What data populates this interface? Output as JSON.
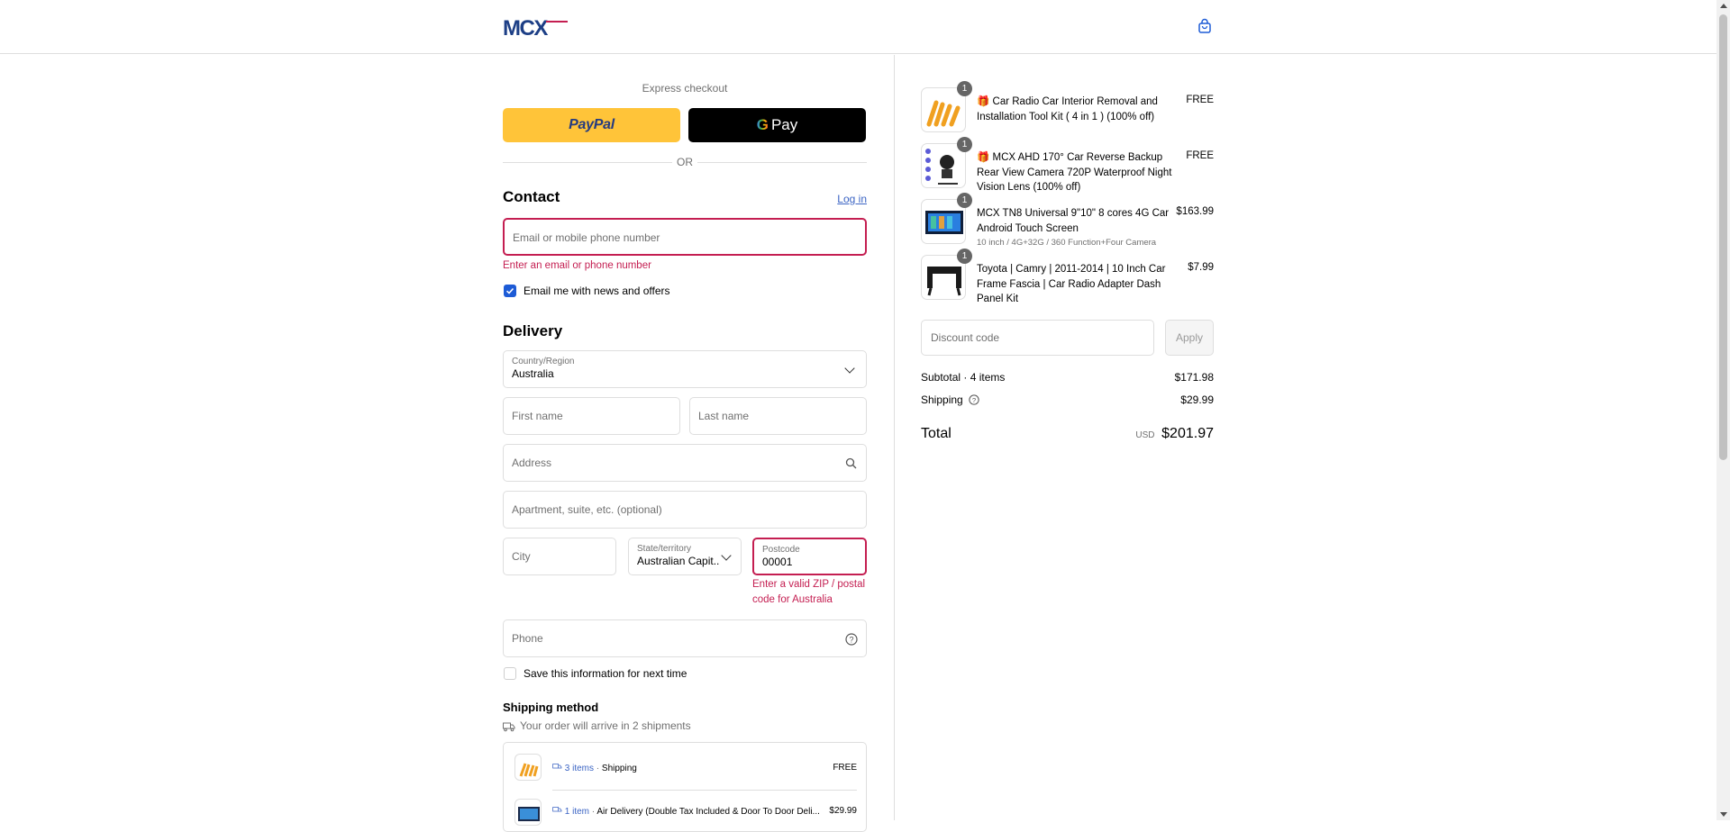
{
  "header": {
    "brand": "MCX"
  },
  "express": {
    "title": "Express checkout",
    "paypal": "PayPal",
    "gpay_g": "G",
    "gpay_text": "Pay",
    "or": "OR"
  },
  "contact": {
    "title": "Contact",
    "login": "Log in",
    "email_placeholder": "Email or mobile phone number",
    "email_error": "Enter an email or phone number",
    "news_label": "Email me with news and offers",
    "news_checked": true
  },
  "delivery": {
    "title": "Delivery",
    "country_label": "Country/Region",
    "country_value": "Australia",
    "first_name": "First name",
    "last_name": "Last name",
    "address": "Address",
    "apartment": "Apartment, suite, etc. (optional)",
    "city": "City",
    "state_label": "State/territory",
    "state_value": "Australian Capit...",
    "postcode_label": "Postcode",
    "postcode_value": "00001",
    "postcode_error_1": "Enter a valid ZIP / postal",
    "postcode_error_2": "code for Australia",
    "phone": "Phone",
    "save_label": "Save this information for next time",
    "save_checked": false
  },
  "shipping": {
    "title": "Shipping method",
    "note": "Your order will arrive in 2 shipments",
    "rows": [
      {
        "count": "3 items",
        "sep": "·",
        "method": "Shipping",
        "price": "FREE"
      },
      {
        "count": "1 item",
        "sep": "·",
        "method": "Air Delivery (Double Tax Included & Door To Door Deli...",
        "price": "$29.99"
      }
    ]
  },
  "summary": {
    "items": [
      {
        "qty": "1",
        "name": "🎁 Car Radio Car Interior Removal and Installation Tool Kit ( 4 in 1 ) (100% off)",
        "variant": "",
        "price": "FREE"
      },
      {
        "qty": "1",
        "name": "🎁 MCX AHD 170° Car Reverse Backup Rear View Camera 720P Waterproof Night Vision Lens (100% off)",
        "variant": "",
        "price": "FREE"
      },
      {
        "qty": "1",
        "name": "MCX TN8 Universal 9\"10\" 8 cores 4G Car Android Touch Screen",
        "variant": "10 inch / 4G+32G / 360 Function+Four Camera",
        "price": "$163.99"
      },
      {
        "qty": "1",
        "name": "Toyota | Camry | 2011-2014 | 10 Inch Car Frame Fascia | Car Radio Adapter Dash Panel Kit",
        "variant": "",
        "price": "$7.99"
      }
    ],
    "discount_placeholder": "Discount code",
    "apply": "Apply",
    "subtotal_label": "Subtotal · 4 items",
    "subtotal": "$171.98",
    "shipping_label": "Shipping",
    "shipping": "$29.99",
    "total_label": "Total",
    "currency": "USD",
    "total": "$201.97"
  },
  "colors": {
    "accent": "#1d5bd6",
    "error": "#c41e51",
    "paypal": "#ffc439",
    "link": "#3b64c4"
  }
}
